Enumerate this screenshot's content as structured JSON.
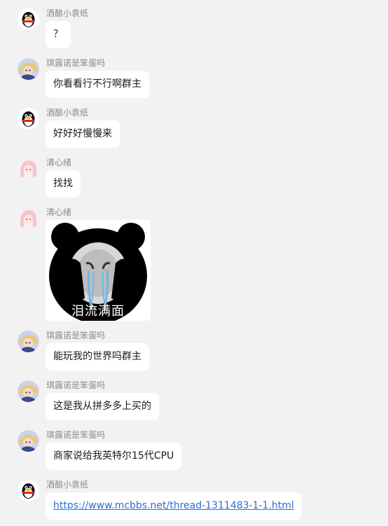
{
  "messages": [
    {
      "sender": "酒酿小袁纸",
      "avatar": "qq-penguin-avatar",
      "text": "？"
    },
    {
      "sender": "琪露诺是笨蛋吗",
      "avatar": "anime-avatar",
      "text": "你看看行不行啊群主"
    },
    {
      "sender": "酒酿小袁纸",
      "avatar": "qq-penguin-avatar",
      "text": "好好好慢慢来"
    },
    {
      "sender": "清心绪",
      "avatar": "anime-avatar",
      "text": "找找"
    },
    {
      "sender": "清心绪",
      "avatar": "anime-avatar",
      "sticker_caption": "泪流满面",
      "sticker_icon": "crying-panda-face"
    },
    {
      "sender": "琪露诺是笨蛋吗",
      "avatar": "anime-avatar",
      "text": "能玩我的世界吗群主"
    },
    {
      "sender": "琪露诺是笨蛋吗",
      "avatar": "anime-avatar",
      "text": "这是我从拼多多上买的"
    },
    {
      "sender": "琪露诺是笨蛋吗",
      "avatar": "anime-avatar",
      "text": "商家说给我英特尔15代CPU"
    },
    {
      "sender": "酒酿小袁纸",
      "avatar": "qq-penguin-avatar",
      "link": "https://www.mcbbs.net/thread-1311483-1-1.html"
    }
  ],
  "colors": {
    "background": "#f2f2f2",
    "bubble": "#ffffff",
    "name": "#8a8a8a",
    "link": "#2a6fd6"
  }
}
